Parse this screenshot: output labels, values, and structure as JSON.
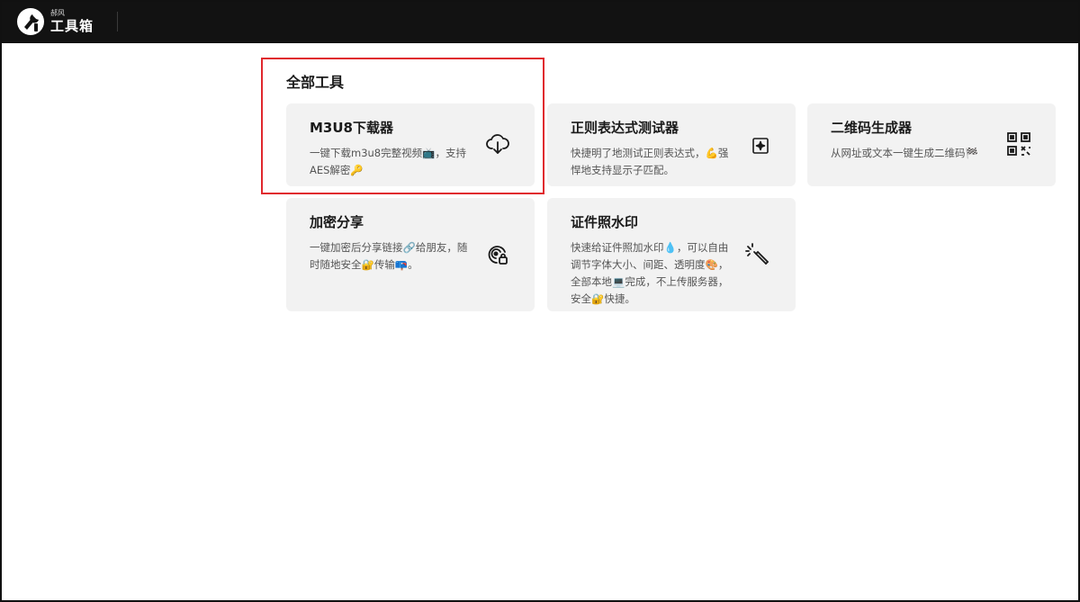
{
  "header": {
    "logo_small": "郝风",
    "logo_big": "工具箱"
  },
  "section": {
    "title": "全部工具"
  },
  "tools": [
    {
      "title": "M3U8下载器",
      "desc": "一键下载m3u8完整视频📺，支持AES解密🔑",
      "icon": "cloud-download-icon"
    },
    {
      "title": "正则表达式测试器",
      "desc": "快捷明了地测试正则表达式，💪强悍地支持显示子匹配。",
      "icon": "sparkle-square-icon"
    },
    {
      "title": "二维码生成器",
      "desc": "从网址或文本一键生成二维码🏁",
      "icon": "qr-code-icon"
    },
    {
      "title": "加密分享",
      "desc": "一键加密后分享链接🔗给朋友，随时随地安全🔐传输📪。",
      "icon": "secure-share-icon"
    },
    {
      "title": "证件照水印",
      "desc": "快速给证件照加水印💧，可以自由调节字体大小、间距、透明度🎨，全部本地💻完成，不上传服务器，安全🔐快捷。",
      "icon": "magic-wand-icon"
    }
  ],
  "colors": {
    "topbar": "#121212",
    "card_bg": "#f2f2f2",
    "highlight": "#e0282e"
  }
}
